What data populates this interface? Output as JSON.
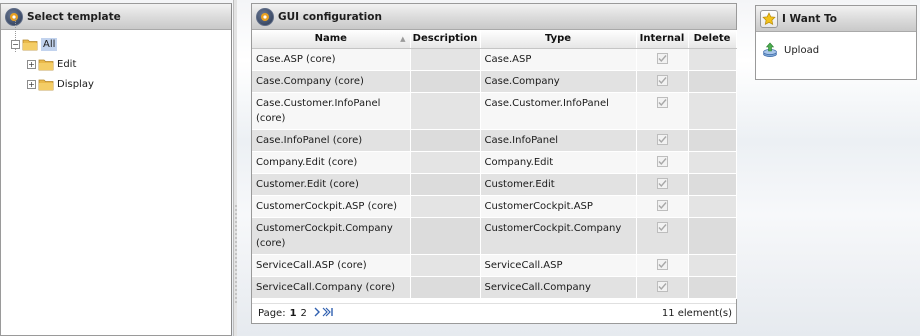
{
  "left_panel": {
    "title": "Select template",
    "tree": {
      "root": {
        "label": "All",
        "expander": "−"
      },
      "children": [
        {
          "label": "Edit",
          "expander": "+"
        },
        {
          "label": "Display",
          "expander": "+"
        }
      ]
    }
  },
  "center_panel": {
    "title": "GUI configuration",
    "columns": [
      "Name",
      "Description",
      "Type",
      "Internal",
      "Delete"
    ],
    "rows": [
      {
        "name": "Case.ASP (core)",
        "description": "",
        "type": "Case.ASP",
        "internal": true
      },
      {
        "name": "Case.Company (core)",
        "description": "",
        "type": "Case.Company",
        "internal": true
      },
      {
        "name": "Case.Customer.InfoPanel (core)",
        "description": "",
        "type": "Case.Customer.InfoPanel",
        "internal": true
      },
      {
        "name": "Case.InfoPanel (core)",
        "description": "",
        "type": "Case.InfoPanel",
        "internal": true
      },
      {
        "name": "Company.Edit (core)",
        "description": "",
        "type": "Company.Edit",
        "internal": true
      },
      {
        "name": "Customer.Edit (core)",
        "description": "",
        "type": "Customer.Edit",
        "internal": true
      },
      {
        "name": "CustomerCockpit.ASP (core)",
        "description": "",
        "type": "CustomerCockpit.ASP",
        "internal": true
      },
      {
        "name": "CustomerCockpit.Company (core)",
        "description": "",
        "type": "CustomerCockpit.Company",
        "internal": true
      },
      {
        "name": "ServiceCall.ASP (core)",
        "description": "",
        "type": "ServiceCall.ASP",
        "internal": true
      },
      {
        "name": "ServiceCall.Company (core)",
        "description": "",
        "type": "ServiceCall.Company",
        "internal": true
      }
    ],
    "pager": {
      "label": "Page:",
      "pages": [
        "1",
        "2"
      ],
      "current_page": "1",
      "next_label": "> >|",
      "count_label": "11 element(s)"
    }
  },
  "right_panel": {
    "title": "I Want To",
    "actions": [
      {
        "label": "Upload",
        "icon": "upload-icon"
      }
    ]
  },
  "colors": {
    "header_gradient_top": "#f2f2f2",
    "header_gradient_bottom": "#c9c9c9",
    "selected_tree_item": "#c2d3ee",
    "pager_link": "#3060b0",
    "folder": "#e9b94a"
  }
}
